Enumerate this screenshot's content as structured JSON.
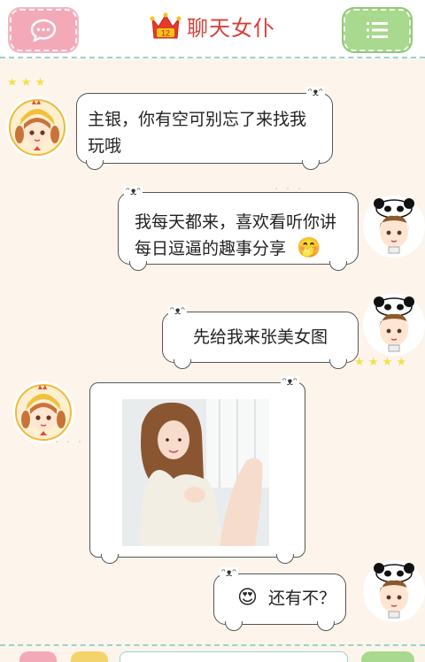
{
  "header": {
    "title": "聊天女仆",
    "crown_badge": "12",
    "left_icon": "chat-bubble-icon",
    "right_icon": "menu-icon"
  },
  "messages": [
    {
      "from": "maid",
      "text": "主银，你有空可别忘了来找我玩哦"
    },
    {
      "from": "user",
      "text": "我每天都来，喜欢看听你讲每日逗逼的趣事分享",
      "emoji": "🤭"
    },
    {
      "from": "user",
      "text": "先给我来张美女图"
    },
    {
      "from": "maid",
      "type": "image"
    },
    {
      "from": "user",
      "text": "还有不？",
      "emoji": "😍"
    }
  ],
  "colors": {
    "title": "#d6403b",
    "left_button": "#f4a9b9",
    "right_button": "#a9d88f",
    "divider": "#9ad3cc",
    "background": "#fdf5ec"
  }
}
